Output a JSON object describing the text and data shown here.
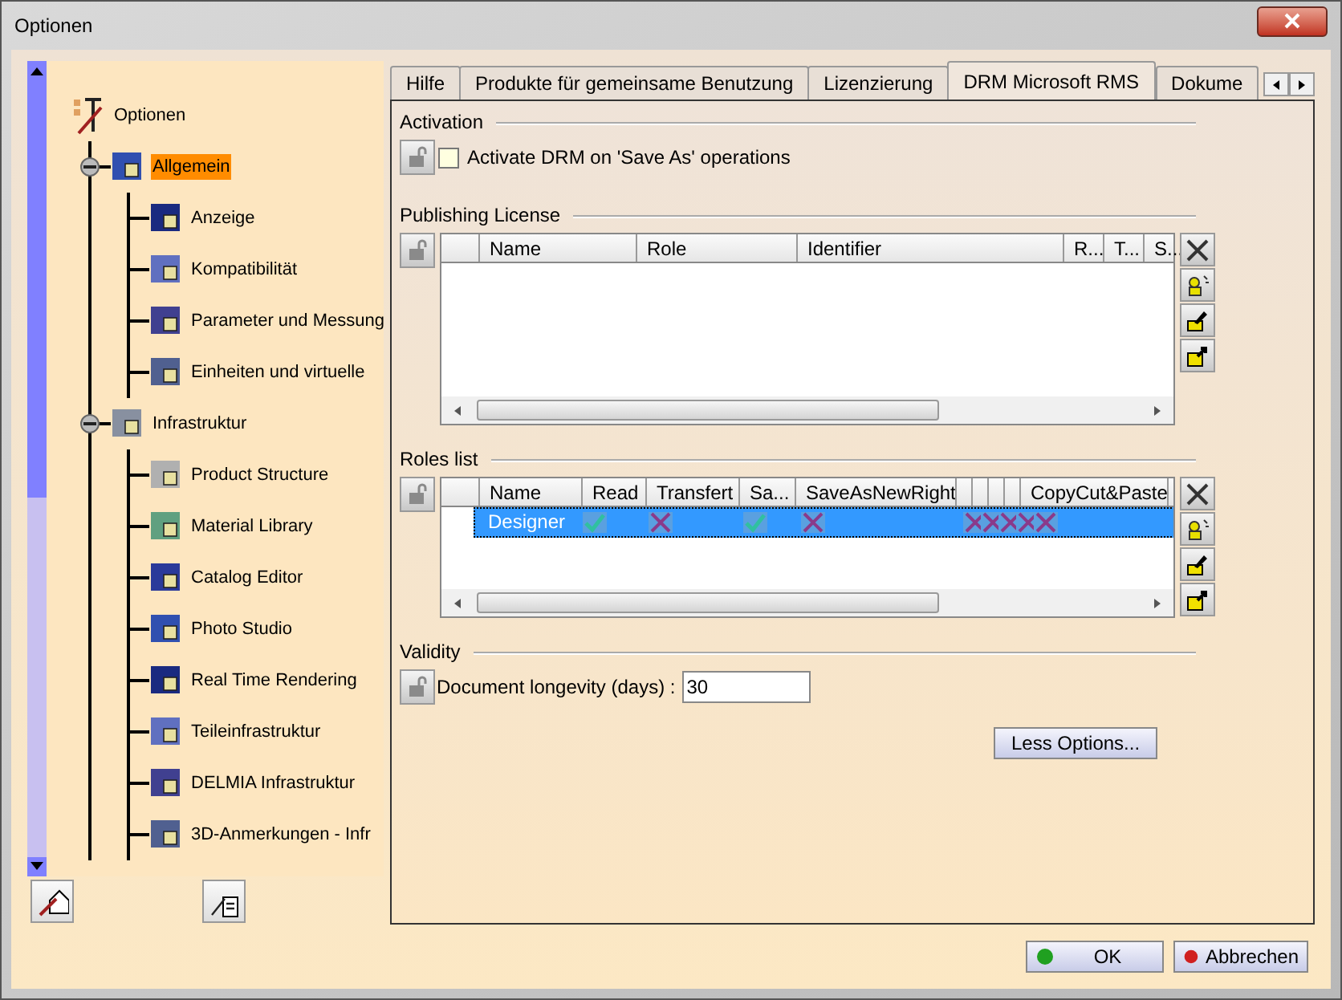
{
  "window": {
    "title": "Optionen"
  },
  "tree": [
    {
      "label": "Optionen",
      "selected": false,
      "children": [
        {
          "label": "Allgemein",
          "selected": true,
          "expanded": true,
          "children": [
            {
              "label": "Anzeige",
              "selected": false
            },
            {
              "label": "Kompatibilität",
              "selected": false
            },
            {
              "label": "Parameter und Messung",
              "selected": false
            },
            {
              "label": "Einheiten und virtuelle",
              "selected": false
            }
          ]
        },
        {
          "label": "Infrastruktur",
          "selected": false,
          "expanded": true,
          "children": [
            {
              "label": "Product Structure",
              "selected": false
            },
            {
              "label": "Material Library",
              "selected": false
            },
            {
              "label": "Catalog Editor",
              "selected": false
            },
            {
              "label": "Photo Studio",
              "selected": false
            },
            {
              "label": "Real Time Rendering",
              "selected": false
            },
            {
              "label": "Teileinfrastruktur",
              "selected": false
            },
            {
              "label": "DELMIA Infrastruktur",
              "selected": false
            },
            {
              "label": "3D-Anmerkungen - Infr",
              "selected": false
            }
          ]
        }
      ]
    }
  ],
  "tabs": [
    {
      "label": "Hilfe",
      "selected": false
    },
    {
      "label": "Produkte für gemeinsame Benutzung",
      "selected": false
    },
    {
      "label": "Lizenzierung",
      "selected": false
    },
    {
      "label": "DRM Microsoft RMS",
      "selected": true
    },
    {
      "label": "Dokume",
      "selected": false
    }
  ],
  "activation": {
    "title": "Activation",
    "checkbox": {
      "label": "Activate DRM on 'Save As' operations",
      "checked": false
    }
  },
  "publishing_license": {
    "title": "Publishing License",
    "columns": [
      {
        "label": "Name",
        "kind": "wide"
      },
      {
        "label": "Role",
        "kind": "wide"
      },
      {
        "label": "Identifier",
        "kind": "wide"
      },
      {
        "label": "R...",
        "kind": "short"
      },
      {
        "label": "T...",
        "kind": "short"
      },
      {
        "label": "S...",
        "kind": "short"
      }
    ]
  },
  "roles_list": {
    "title": "Roles list",
    "columns": [
      {
        "label": "Name",
        "kind": "wide"
      },
      {
        "label": "Read",
        "kind": "wide"
      },
      {
        "label": "Transfert",
        "kind": "wide"
      },
      {
        "label": "Sa...",
        "kind": "wide"
      },
      {
        "label": "SaveAsNewRight",
        "kind": "wide"
      },
      {
        "kind": "narrow"
      },
      {
        "kind": "narrow"
      },
      {
        "kind": "narrow"
      },
      {
        "kind": "narrow"
      },
      {
        "label": "CopyCut&Paste",
        "kind": "wide"
      }
    ],
    "rows": [
      {
        "name": "Designer",
        "selected": true,
        "cells": [
          {
            "allowed": true
          },
          {
            "allowed": false
          },
          {
            "allowed": true
          },
          {
            "allowed": false
          },
          {
            "allowed": false
          },
          {
            "allowed": false
          },
          {
            "allowed": false
          },
          {
            "allowed": false
          },
          {
            "allowed": false
          }
        ]
      }
    ]
  },
  "validity": {
    "title": "Validity",
    "field": {
      "label": "Document longevity (days) :",
      "value": "30"
    }
  },
  "less_options_button": "Less Options...",
  "buttons": [
    {
      "label": "OK",
      "kind": "ok"
    },
    {
      "label": "Abbrechen",
      "kind": "cancel"
    }
  ]
}
